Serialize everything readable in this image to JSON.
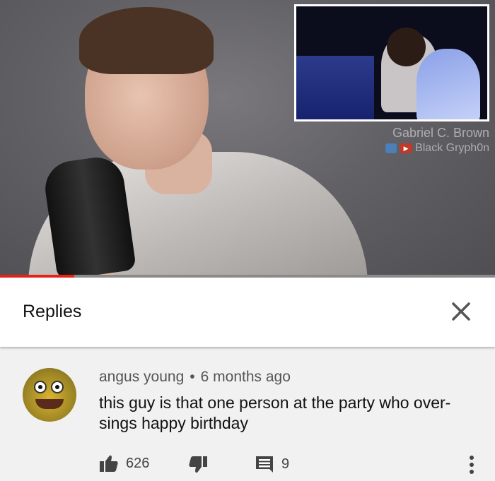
{
  "video": {
    "watermark_name": "Gabriel C. Brown",
    "watermark_channel": "Black Gryph0n",
    "progress_fraction": 0.15
  },
  "replies": {
    "title": "Replies"
  },
  "comment": {
    "author": "angus young",
    "separator": "•",
    "time": "6 months ago",
    "text": "this guy is that one person at the party who over-sings happy birthday",
    "likes": "626",
    "reply_count": "9"
  },
  "colors": {
    "progress": "#e62117",
    "icon": "#444444"
  },
  "icons": [
    "close-icon",
    "thumbs-up-icon",
    "thumbs-down-icon",
    "reply-icon",
    "more-vert-icon"
  ]
}
